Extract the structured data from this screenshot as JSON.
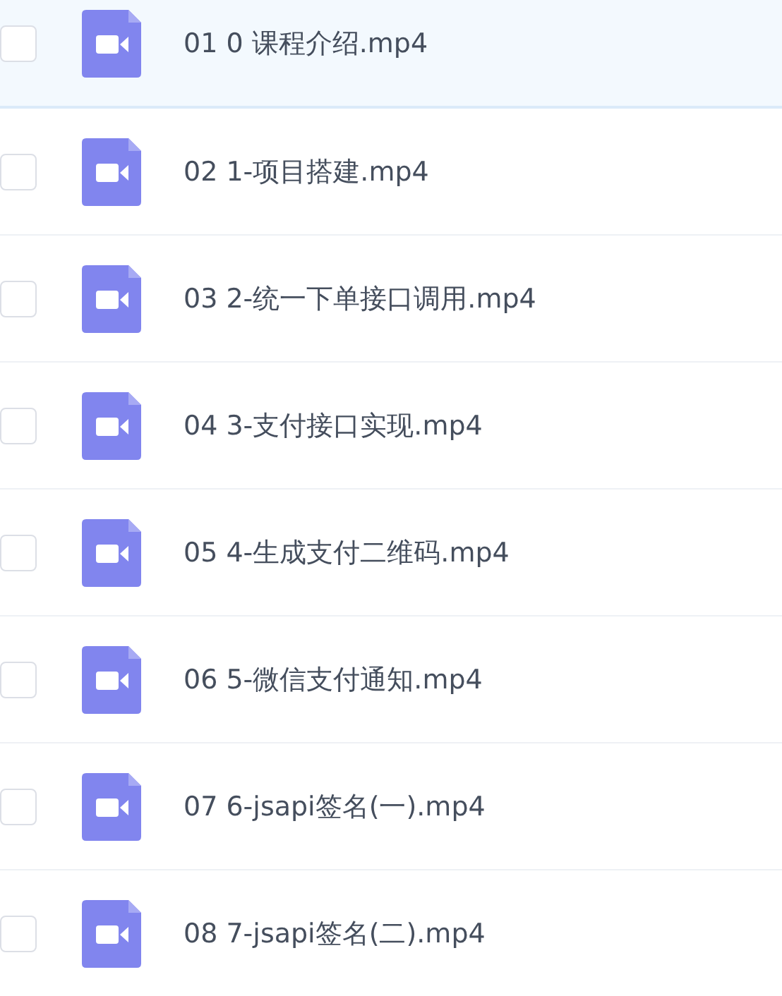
{
  "files": [
    {
      "name": "01 0 课程介绍.mp4",
      "selected": true,
      "checked": false
    },
    {
      "name": "02 1-项目搭建.mp4",
      "selected": false,
      "checked": false
    },
    {
      "name": "03 2-统一下单接口调用.mp4",
      "selected": false,
      "checked": false
    },
    {
      "name": "04 3-支付接口实现.mp4",
      "selected": false,
      "checked": false
    },
    {
      "name": "05 4-生成支付二维码.mp4",
      "selected": false,
      "checked": false
    },
    {
      "name": "06 5-微信支付通知.mp4",
      "selected": false,
      "checked": false
    },
    {
      "name": "07 6-jsapi签名(一).mp4",
      "selected": false,
      "checked": false
    },
    {
      "name": "08 7-jsapi签名(二).mp4",
      "selected": false,
      "checked": false
    }
  ]
}
